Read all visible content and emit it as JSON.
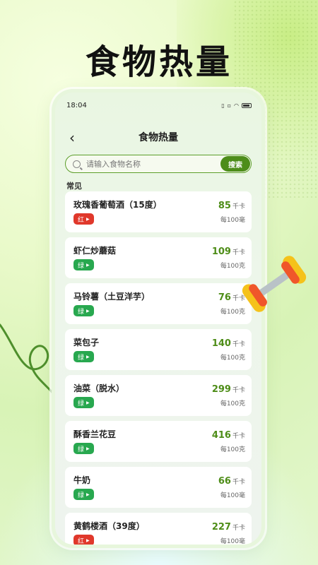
{
  "headline": "食物热量",
  "status": {
    "time": "18:04"
  },
  "nav": {
    "title": "食物热量"
  },
  "search": {
    "placeholder": "请输入食物名称",
    "button": "搜索"
  },
  "section": "常见",
  "items": [
    {
      "name": "玫瑰香葡萄酒（15度）",
      "badge": "红",
      "kcal": "85",
      "unit": "千卡",
      "per": "每100毫"
    },
    {
      "name": "虾仁炒蘑菇",
      "badge": "绿",
      "kcal": "109",
      "unit": "千卡",
      "per": "每100克"
    },
    {
      "name": "马铃薯（土豆洋芋）",
      "badge": "绿",
      "kcal": "76",
      "unit": "千卡",
      "per": "每100克"
    },
    {
      "name": "菜包子",
      "badge": "绿",
      "kcal": "140",
      "unit": "千卡",
      "per": "每100克"
    },
    {
      "name": "油菜（脱水）",
      "badge": "绿",
      "kcal": "299",
      "unit": "千卡",
      "per": "每100克"
    },
    {
      "name": "酥香兰花豆",
      "badge": "绿",
      "kcal": "416",
      "unit": "千卡",
      "per": "每100克"
    },
    {
      "name": "牛奶",
      "badge": "绿",
      "kcal": "66",
      "unit": "千卡",
      "per": "每100毫"
    },
    {
      "name": "黄鹤楼酒（39度）",
      "badge": "红",
      "kcal": "227",
      "unit": "千卡",
      "per": "每100毫"
    }
  ],
  "colors": {
    "accent": "#4e8d18",
    "red_badge": "#e0382b",
    "green_badge": "#28a84f"
  }
}
